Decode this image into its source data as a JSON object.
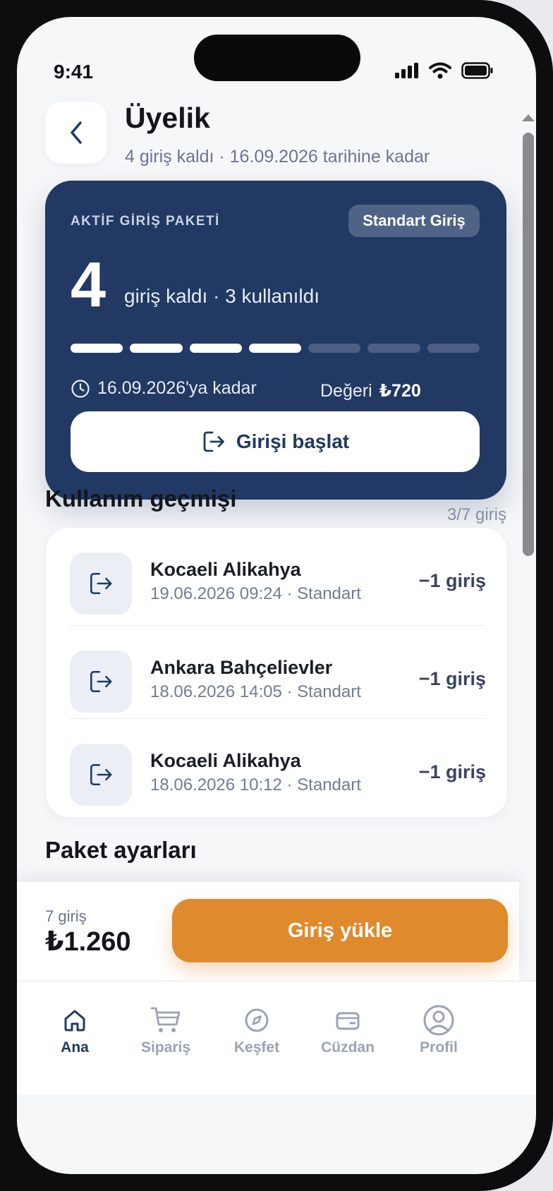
{
  "status_bar": {
    "time": "9:41"
  },
  "header": {
    "title": "Üyelik",
    "subtitle": "4 giriş kaldı · 16.09.2026 tarihine kadar"
  },
  "package_card": {
    "label": "AKTİF GİRİŞ PAKETİ",
    "badge": "Standart Giriş",
    "remaining_count": "4",
    "remaining_label": "giriş kaldı · 3 kullanıldı",
    "segments_total": 7,
    "segments_remaining": 4,
    "expiry": "16.09.2026'ya kadar",
    "value_label": "Değeri",
    "value_amount": "₺720",
    "start_button": "Girişi başlat"
  },
  "history": {
    "title": "Kullanım geçmişi",
    "meta": "3/7 giriş",
    "items": [
      {
        "title": "Kocaeli Alikahya",
        "subtitle": "19.06.2026 09:24 · Standart",
        "amount": "−1 giriş"
      },
      {
        "title": "Ankara Bahçelievler",
        "subtitle": "18.06.2026 14:05 · Standart",
        "amount": "−1 giriş"
      },
      {
        "title": "Kocaeli Alikahya",
        "subtitle": "18.06.2026 10:12 · Standart",
        "amount": "−1 giriş"
      }
    ]
  },
  "settings": {
    "title": "Paket ayarları"
  },
  "purchase_bar": {
    "count": "7 giriş",
    "price": "₺1.260",
    "button": "Giriş yükle"
  },
  "tabbar": {
    "items": [
      {
        "label": "Ana",
        "icon": "home-icon",
        "active": true
      },
      {
        "label": "Sipariş",
        "icon": "cart-icon",
        "active": false
      },
      {
        "label": "Keşfet",
        "icon": "compass-icon",
        "active": false
      },
      {
        "label": "Cüzdan",
        "icon": "wallet-icon",
        "active": false
      },
      {
        "label": "Profil",
        "icon": "profile-icon",
        "active": false
      }
    ]
  },
  "colors": {
    "primary": "#213963",
    "accent": "#e08a2e",
    "muted_text": "#6b7590",
    "background": "#f6f7f9"
  }
}
